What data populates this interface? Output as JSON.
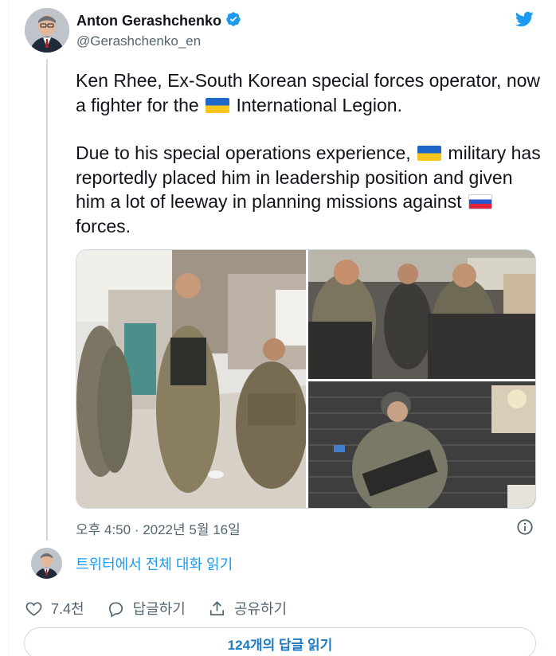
{
  "author": {
    "name": "Anton Gerashchenko",
    "handle": "@Gerashchenko_en",
    "verified": true
  },
  "icons": {
    "verified": "verified-badge-icon",
    "logo": "twitter-bird-icon",
    "info": "info-icon",
    "like": "heart-icon",
    "reply": "speech-bubble-icon",
    "share": "share-upload-icon",
    "flag_ukraine": "ukraine-flag-icon",
    "flag_russia": "russia-flag-icon"
  },
  "tweet": {
    "line1_before_flag": "Ken Rhee, Ex-South Korean special forces operator, now a fighter for the ",
    "line1_after_flag": " International Legion.",
    "para2_before_flag": "Due to his special operations experience, ",
    "para2_middle": " military has reportedly placed him in leadership position and given him a lot of leeway in planning missions against ",
    "para2_after_flag": " forces."
  },
  "media": {
    "count": 3
  },
  "timestamp": "오후 4:50 · 2022년 5월 16일",
  "read_conversation": "트위터에서 전체 대화 읽기",
  "actions": {
    "like_count": "7.4천",
    "reply_label": "답글하기",
    "share_label": "공유하기"
  },
  "replies_button": "124개의 답글 읽기",
  "colors": {
    "accent": "#1d9bf0",
    "text": "#0f1419",
    "muted": "#536471",
    "border": "#cfd9de"
  }
}
